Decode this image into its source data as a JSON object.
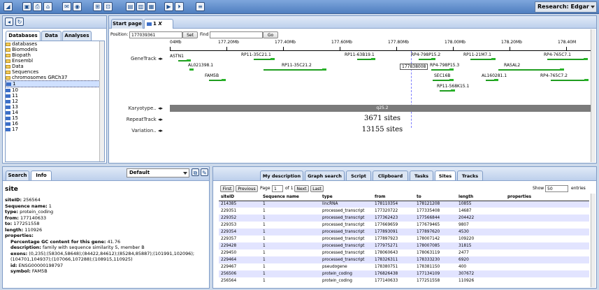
{
  "toolbar": {
    "research_label": "Research: Edgar"
  },
  "left_panel": {
    "tabs": [
      "Databases",
      "Data",
      "Analyses"
    ]
  },
  "tree": [
    {
      "label": "databases",
      "level": 0,
      "icon": "folder"
    },
    {
      "label": "Biomodels",
      "level": 1,
      "icon": "db"
    },
    {
      "label": "Biopath",
      "level": 1,
      "icon": "db"
    },
    {
      "label": "Ensembl",
      "level": 1,
      "icon": "db"
    },
    {
      "label": "Data",
      "level": 2,
      "icon": "folder"
    },
    {
      "label": "Sequences",
      "level": 2,
      "icon": "folder"
    },
    {
      "label": "chromosomes GRCh37",
      "level": 3,
      "icon": "folder"
    },
    {
      "label": "1",
      "level": 4,
      "icon": "chr",
      "selected": true
    },
    {
      "label": "10",
      "level": 4,
      "icon": "chr"
    },
    {
      "label": "11",
      "level": 4,
      "icon": "chr"
    },
    {
      "label": "12",
      "level": 4,
      "icon": "chr"
    },
    {
      "label": "13",
      "level": 4,
      "icon": "chr"
    },
    {
      "label": "14",
      "level": 4,
      "icon": "chr"
    },
    {
      "label": "15",
      "level": 4,
      "icon": "chr"
    },
    {
      "label": "16",
      "level": 4,
      "icon": "chr"
    },
    {
      "label": "17",
      "level": 4,
      "icon": "chr"
    }
  ],
  "viewer": {
    "tabs": [
      "Start page",
      "1"
    ],
    "close": "X",
    "position_label": "Position:",
    "position_value": "177039361",
    "set_label": "Set",
    "find_label": "Find",
    "go_label": "Go",
    "ruler": [
      "04Mb",
      "177.20Mb",
      "177.40Mb",
      "177.60Mb",
      "177.80Mb",
      "178.00Mb",
      "178.20Mb",
      "178.40M"
    ],
    "cursor_value": "177838008",
    "tracks": [
      "GeneTrack",
      "Karyotype..",
      "RepeatTrack",
      "Variation.."
    ],
    "karyotype_band": "q25.2",
    "repeat_sites": "3671 sites",
    "variation_sites": "13155 sites",
    "genes": [
      "ASTN1",
      "RP11-35C21.1",
      "RP11-63B19.1",
      "RP4-798P15.2",
      "RP11-21M7.1",
      "RP4-765C7.1",
      "AL021398.1",
      "RP11-35C21.2",
      "RP4-798P15.3",
      "RASAL2",
      "FAM5B",
      "SEC16B",
      "AL160281.1",
      "RP4-765C7.2",
      "RP11-568K15.1"
    ]
  },
  "info": {
    "tabs": [
      "Search",
      "Info"
    ],
    "dropdown": "Default",
    "title": "site",
    "lines": [
      {
        "k": "siteID:",
        "v": "256564"
      },
      {
        "k": "Sequence name:",
        "v": "1"
      },
      {
        "k": "type:",
        "v": "protein_coding"
      },
      {
        "k": "from:",
        "v": "177140633"
      },
      {
        "k": "to:",
        "v": "177251558"
      },
      {
        "k": "length:",
        "v": "110926"
      },
      {
        "k": "properties:",
        "v": ""
      },
      {
        "k": "Percentage GC content for this gene:",
        "v": "41.76"
      },
      {
        "k": "description:",
        "v": "family with sequence similarity 5, member B"
      },
      {
        "k": "exons:",
        "v": "(0,235);(58304,58648);(84422,84612);(85284,85887);(101991,102096);(104701,104937);(107066,107288);(108915,110925)"
      },
      {
        "k": "id:",
        "v": "ENSG00000198797"
      },
      {
        "k": "symbol:",
        "v": "FAM5B"
      }
    ]
  },
  "bottom": {
    "tabs": [
      "My description",
      "Graph search",
      "Script",
      "Clipboard",
      "Tasks",
      "Sites",
      "Tracks"
    ],
    "active": "Sites",
    "pager": {
      "first": "First",
      "previous": "Previous",
      "page": "Page",
      "page_value": "1",
      "of": "of 1",
      "next": "Next",
      "last": "Last"
    },
    "show_label": "Show",
    "show_value": "50",
    "entries": "entries",
    "columns": [
      "siteID",
      "Sequence name",
      "type",
      "from",
      "to",
      "length",
      "properties"
    ],
    "rows": [
      [
        "214385",
        "1",
        "lincRNA",
        "178110354",
        "178121208",
        "10855",
        ""
      ],
      [
        "229351",
        "1",
        "processed_transcript",
        "177320722",
        "177335408",
        "14687",
        ""
      ],
      [
        "229352",
        "1",
        "processed_transcript",
        "177362423",
        "177566844",
        "204422",
        ""
      ],
      [
        "229353",
        "1",
        "processed_transcript",
        "177669659",
        "177679465",
        "9807",
        ""
      ],
      [
        "229354",
        "1",
        "processed_transcript",
        "177893091",
        "177897620",
        "4530",
        ""
      ],
      [
        "229357",
        "1",
        "processed_transcript",
        "177897923",
        "178007142",
        "109220",
        ""
      ],
      [
        "229428",
        "1",
        "processed_transcript",
        "177975271",
        "178007085",
        "31815",
        ""
      ],
      [
        "229450",
        "1",
        "processed_transcript",
        "178060643",
        "178063119",
        "2477",
        ""
      ],
      [
        "229464",
        "1",
        "processed_transcript",
        "178326311",
        "178333230",
        "6920",
        ""
      ],
      [
        "229467",
        "1",
        "pseudogene",
        "178380751",
        "178381150",
        "400",
        ""
      ],
      [
        "256506",
        "1",
        "protein_coding",
        "176826438",
        "177134109",
        "307672",
        ""
      ],
      [
        "256564",
        "1",
        "protein_coding",
        "177140633",
        "177251558",
        "110926",
        ""
      ]
    ]
  }
}
